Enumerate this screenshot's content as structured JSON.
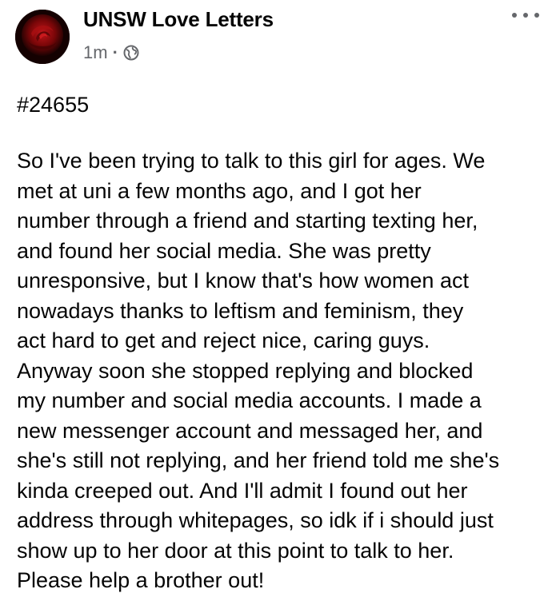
{
  "post": {
    "author": "UNSW Love Letters",
    "timestamp": "1m",
    "separator": "·",
    "audience_icon": "globe-icon",
    "more_icon": "more-options-icon",
    "hashtag": "#24655",
    "lines": [
      "So I've been trying to talk to this girl for ages. We",
      "met at uni a few months ago, and I got her",
      "number through a friend and starting texting her,",
      "and found her social media.  She was pretty",
      "unresponsive, but I know that's how women act",
      "nowadays thanks to leftism and feminism, they",
      "act hard to get and reject nice, caring guys.",
      "Anyway soon she stopped replying and blocked",
      "my number and social media accounts. I made a",
      "new messenger account and messaged her, and",
      "she's still not replying, and her friend told me she's",
      "kinda creeped out. And I'll admit I found out her",
      "address through whitepages, so idk if i should just",
      "show up to her door at this point to talk to her.",
      "Please help a brother out!"
    ]
  },
  "colors": {
    "text": "#050505",
    "meta": "#65676b",
    "background": "#ffffff",
    "avatar_rose": "#8b0a0a"
  }
}
